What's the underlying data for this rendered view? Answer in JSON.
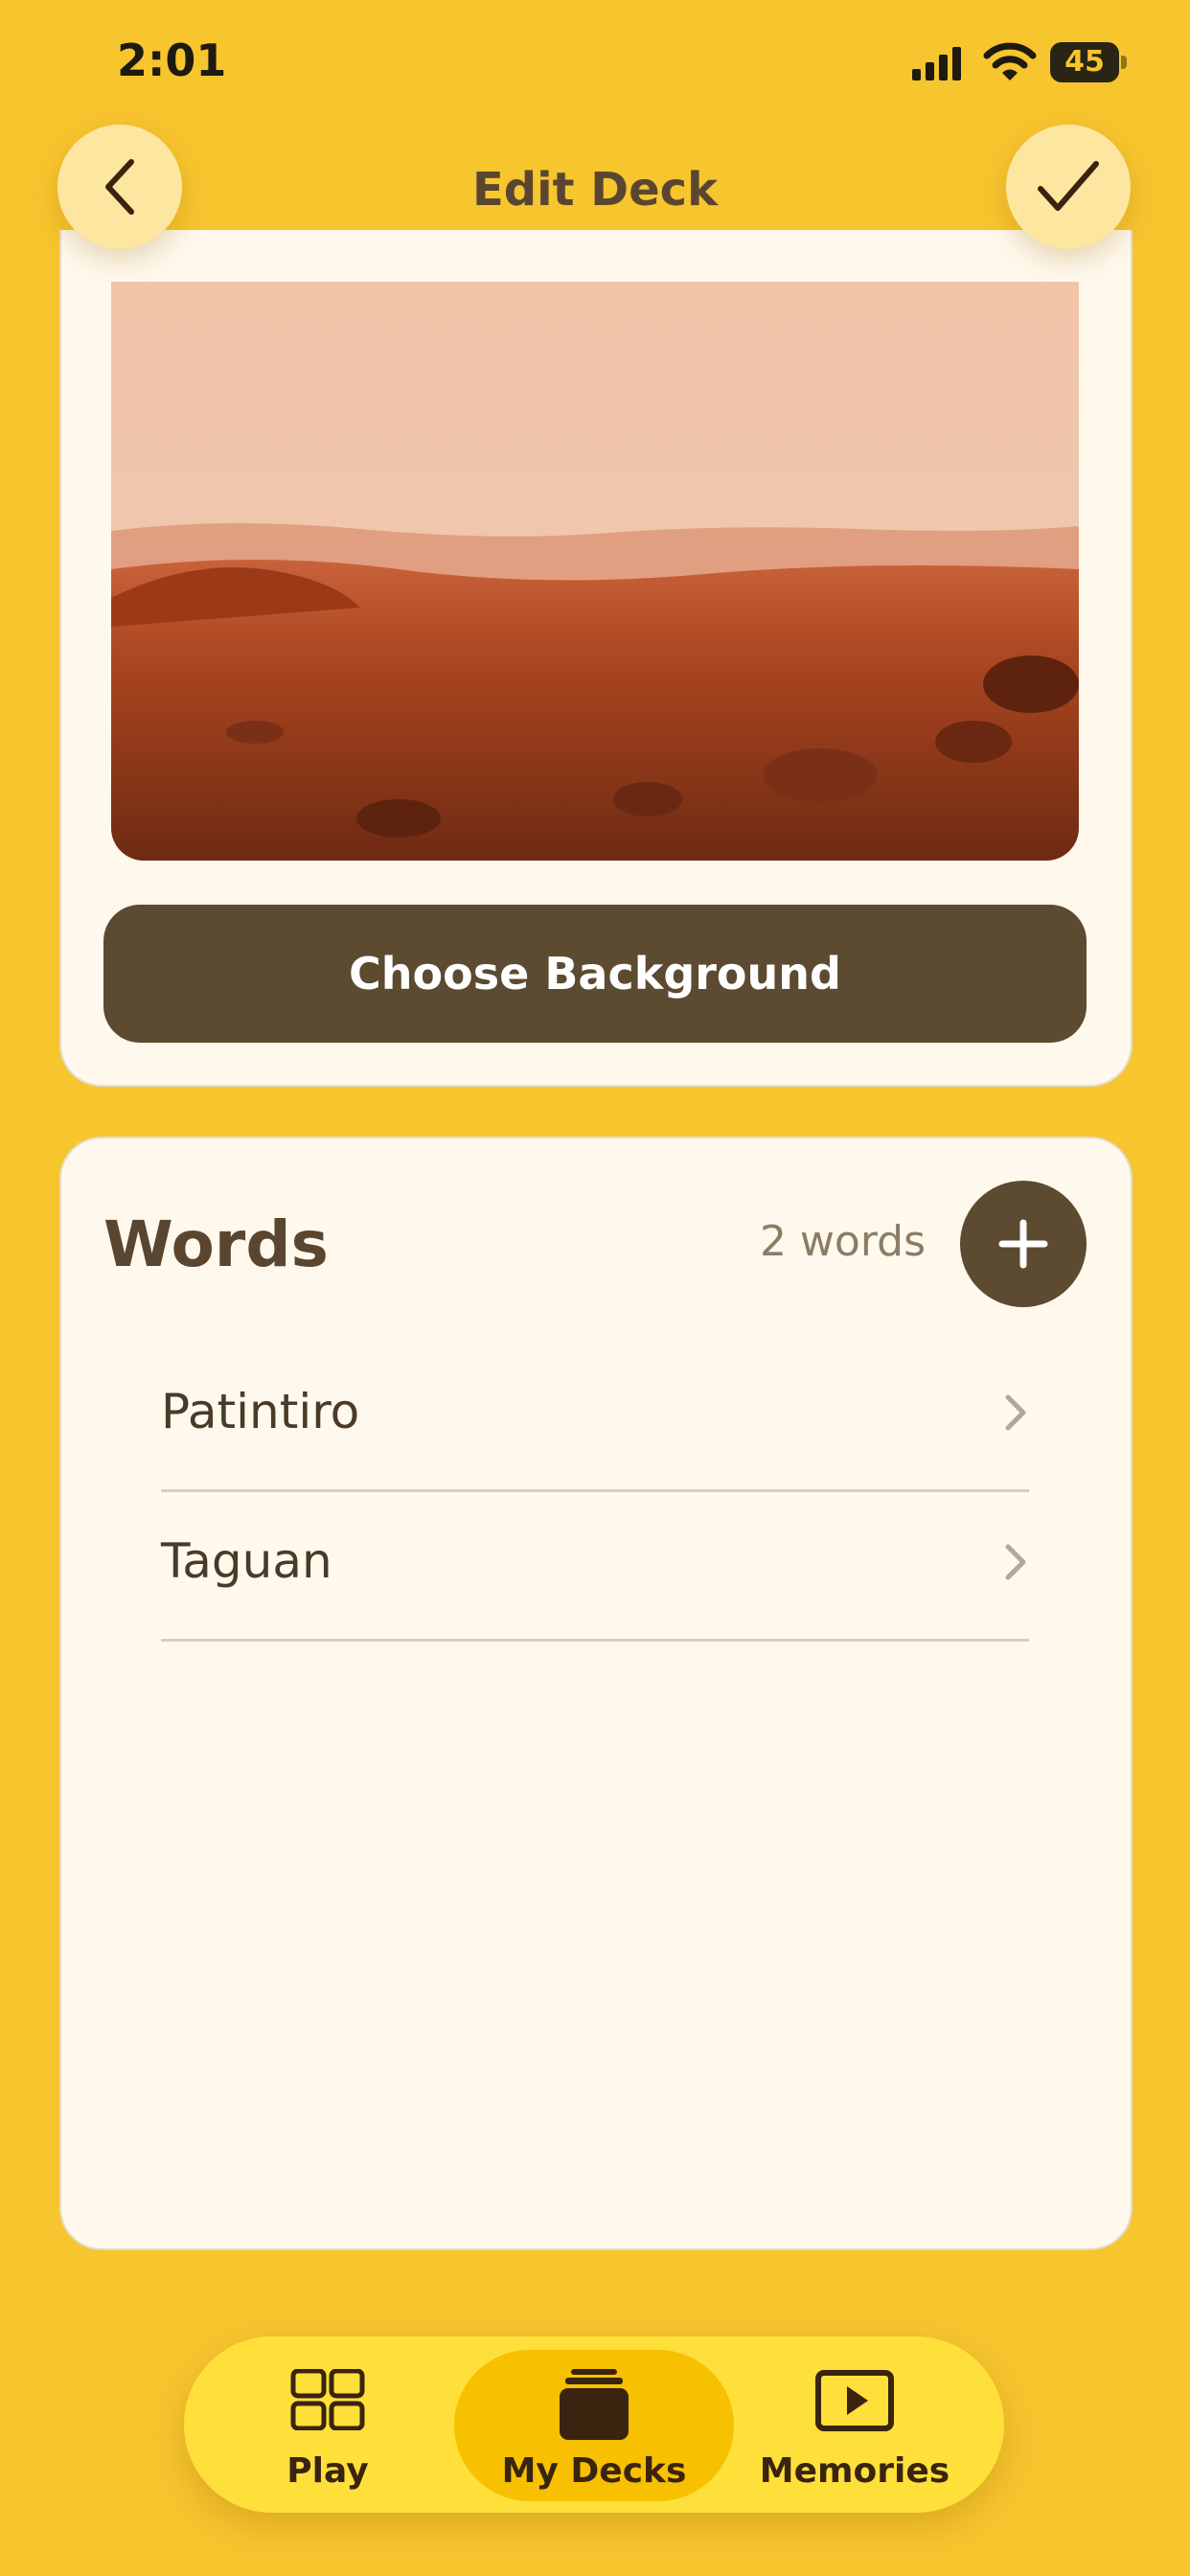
{
  "status_bar": {
    "time": "2:01",
    "battery": "45"
  },
  "header": {
    "title": "Edit Deck"
  },
  "background_card": {
    "choose_label": "Choose Background"
  },
  "words_card": {
    "title": "Words",
    "count": "2 words",
    "items": [
      {
        "label": "Patintiro"
      },
      {
        "label": "Taguan"
      }
    ]
  },
  "tab_bar": {
    "tabs": [
      {
        "label": "Play",
        "icon": "grid-icon"
      },
      {
        "label": "My Decks",
        "icon": "decks-icon",
        "active": true
      },
      {
        "label": "Memories",
        "icon": "play-box-icon"
      }
    ]
  },
  "colors": {
    "background": "#F7C52E",
    "card": "#FEF9EC",
    "primary_dark": "#5C4A31",
    "tab_bar": "#FFE03A",
    "tab_active": "#F7C000"
  }
}
